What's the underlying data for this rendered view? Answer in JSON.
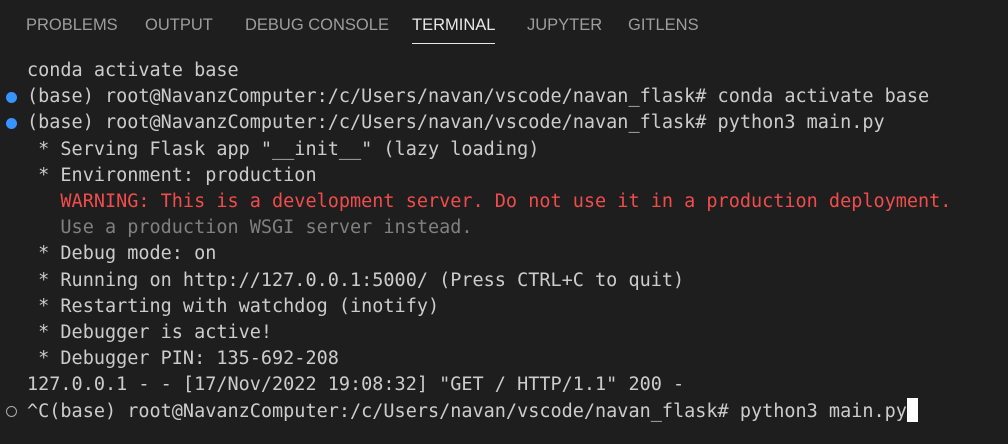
{
  "panel": {
    "tabs": [
      {
        "label": "PROBLEMS"
      },
      {
        "label": "OUTPUT"
      },
      {
        "label": "DEBUG CONSOLE"
      },
      {
        "label": "TERMINAL"
      },
      {
        "label": "JUPYTER"
      },
      {
        "label": "GITLENS"
      }
    ],
    "active_tab": "TERMINAL"
  },
  "colors": {
    "background": "#1e1e1e",
    "text": "#cccccc",
    "warning": "#f14c4c",
    "dim": "#808080",
    "success_dot": "#3794ff"
  },
  "terminal": {
    "lines": [
      {
        "text": "conda activate base"
      },
      {
        "text": "(base) root@NavanzComputer:/c/Users/navan/vscode/navan_flask# conda activate base",
        "decoration": "success"
      },
      {
        "text": "(base) root@NavanzComputer:/c/Users/navan/vscode/navan_flask# python3 main.py",
        "decoration": "success"
      },
      {
        "text": " * Serving Flask app \"__init__\" (lazy loading)"
      },
      {
        "text": " * Environment: production"
      },
      {
        "text": "   WARNING: This is a development server. Do not use it in a production deployment.",
        "style": "warning"
      },
      {
        "text": "   Use a production WSGI server instead.",
        "style": "dim"
      },
      {
        "text": " * Debug mode: on"
      },
      {
        "text": " * Running on http://127.0.0.1:5000/ (Press CTRL+C to quit)"
      },
      {
        "text": " * Restarting with watchdog (inotify)"
      },
      {
        "text": " * Debugger is active!"
      },
      {
        "text": " * Debugger PIN: 135-692-208"
      },
      {
        "text": "127.0.0.1 - - [17/Nov/2022 19:08:32] \"GET / HTTP/1.1\" 200 -"
      },
      {
        "text": "^C(base) root@NavanzComputer:/c/Users/navan/vscode/navan_flask# python3 main.py",
        "decoration": "pending",
        "cursor": true
      }
    ]
  }
}
